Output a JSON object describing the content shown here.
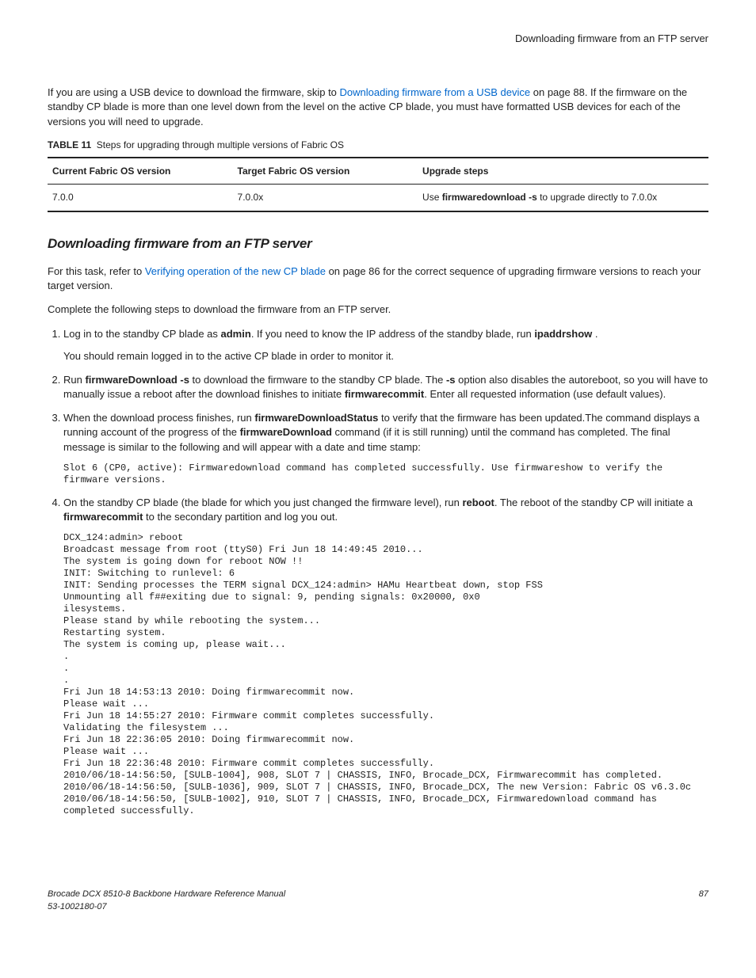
{
  "header": {
    "right": "Downloading firmware from an FTP server"
  },
  "intro": {
    "p1a": "If you are using a USB device to download the firmware, skip to ",
    "p1link": "Downloading firmware from a USB device",
    "p1b": " on page 88. If the firmware on the standby CP blade is more than one level down from the level on the active CP blade, you must have formatted USB devices for each of the versions you will need to upgrade."
  },
  "table": {
    "captionLabel": "TABLE 11",
    "captionText": "Steps for upgrading through multiple versions of Fabric OS",
    "h1": "Current Fabric OS version",
    "h2": "Target Fabric OS version",
    "h3": "Upgrade steps",
    "r1c1": "7.0.0",
    "r1c2": "7.0.0x",
    "r1c3a": "Use ",
    "r1c3b": "firmwaredownload -s",
    "r1c3c": " to upgrade directly to 7.0.0x"
  },
  "section": {
    "title": "Downloading firmware from an FTP server"
  },
  "body": {
    "p1a": "For this task, refer to ",
    "p1link": "Verifying operation of the new CP blade",
    "p1b": " on page 86 for the correct sequence of upgrading firmware versions to reach your target version.",
    "p2": "Complete the following steps to download the firmware from an FTP server."
  },
  "steps": {
    "s1a": "Log in to the standby CP blade as ",
    "s1b": "admin",
    "s1c": ". If you need to know the IP address of the standby blade, run ",
    "s1d": "ipaddrshow",
    "s1e": " .",
    "s1p2": "You should remain logged in to the active CP blade in order to monitor it.",
    "s2a": "Run ",
    "s2b": "firmwareDownload -s",
    "s2c": " to download the firmware to the standby CP blade. The ",
    "s2d": "-s",
    "s2e": " option also disables the autoreboot, so you will have to manually issue a reboot after the download finishes to initiate ",
    "s2f": "firmwarecommit",
    "s2g": ". Enter all requested information (use default values).",
    "s3a": "When the download process finishes, run ",
    "s3b": "firmwareDownloadStatus",
    "s3c": " to verify that the firmware has been updated.The command displays a running account of the progress of the ",
    "s3d": "firmwareDownload",
    "s3e": " command (if it is still running) until the command has completed. The final message is similar to the following and will appear with a date and time stamp:",
    "s3code": "Slot 6 (CP0, active): Firmwaredownload command has completed successfully. Use firmwareshow to verify the firmware versions.",
    "s4a": "On the standby CP blade (the blade for which you just changed the firmware level), run ",
    "s4b": "reboot",
    "s4c": ". The reboot of the standby CP will initiate a ",
    "s4d": "firmwarecommit",
    "s4e": " to the secondary partition and log you out.",
    "s4code": "DCX_124:admin> reboot\nBroadcast message from root (ttyS0) Fri Jun 18 14:49:45 2010...\nThe system is going down for reboot NOW !!\nINIT: Switching to runlevel: 6\nINIT: Sending processes the TERM signal DCX_124:admin> HAMu Heartbeat down, stop FSS\nUnmounting all f##exiting due to signal: 9, pending signals: 0x20000, 0x0\nilesystems.\nPlease stand by while rebooting the system...\nRestarting system.\nThe system is coming up, please wait...\n.\n.\n.\nFri Jun 18 14:53:13 2010: Doing firmwarecommit now.\nPlease wait ...\nFri Jun 18 14:55:27 2010: Firmware commit completes successfully.\nValidating the filesystem ...\nFri Jun 18 22:36:05 2010: Doing firmwarecommit now.\nPlease wait ...\nFri Jun 18 22:36:48 2010: Firmware commit completes successfully.\n2010/06/18-14:56:50, [SULB-1004], 908, SLOT 7 | CHASSIS, INFO, Brocade_DCX, Firmwarecommit has completed.\n2010/06/18-14:56:50, [SULB-1036], 909, SLOT 7 | CHASSIS, INFO, Brocade_DCX, The new Version: Fabric OS v6.3.0c\n2010/06/18-14:56:50, [SULB-1002], 910, SLOT 7 | CHASSIS, INFO, Brocade_DCX, Firmwaredownload command has completed successfully."
  },
  "footer": {
    "left1": "Brocade DCX 8510-8 Backbone Hardware Reference Manual",
    "left2": "53-1002180-07",
    "right": "87"
  }
}
